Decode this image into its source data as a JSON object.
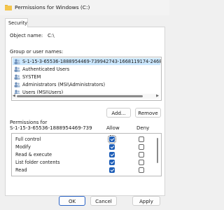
{
  "window": {
    "title": "Permissions for Windows (C:)",
    "icon": "folder-icon"
  },
  "tabs": [
    {
      "label": "Security",
      "active": true
    }
  ],
  "object": {
    "label": "Object name:",
    "value": "C:\\"
  },
  "group_label": "Group or user names:",
  "principals": [
    {
      "name": "S-1-15-3-65536-1888954469-739942743-1668119174-2468...",
      "icon": "users-icon",
      "selected": true
    },
    {
      "name": "Authenticated Users",
      "icon": "users-icon",
      "selected": false
    },
    {
      "name": "SYSTEM",
      "icon": "users-icon",
      "selected": false
    },
    {
      "name": "Administrators (MSI\\Administrators)",
      "icon": "users-icon",
      "selected": false
    },
    {
      "name": "Users (MSI\\Users)",
      "icon": "users-icon",
      "selected": false
    }
  ],
  "principal_buttons": {
    "add": "Add...",
    "remove": "Remove"
  },
  "permissions": {
    "header_line1": "Permissions for",
    "header_line2": "S-1-15-3-65536-1888954469-739",
    "allow_label": "Allow",
    "deny_label": "Deny",
    "rows": [
      {
        "name": "Full control",
        "allow": true,
        "deny": false
      },
      {
        "name": "Modify",
        "allow": true,
        "deny": false
      },
      {
        "name": "Read & execute",
        "allow": true,
        "deny": false
      },
      {
        "name": "List folder contents",
        "allow": true,
        "deny": false
      },
      {
        "name": "Read",
        "allow": true,
        "deny": false
      }
    ]
  },
  "footer": {
    "ok": "OK",
    "cancel": "Cancel",
    "apply": "Apply"
  },
  "colors": {
    "accent": "#1f5fb8",
    "selection": "#cce8ff",
    "primary_border": "#2a63c6"
  }
}
